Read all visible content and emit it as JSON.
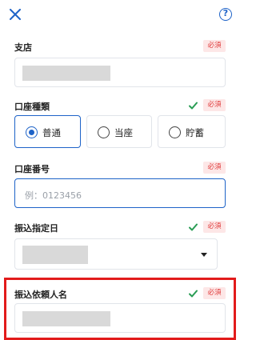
{
  "header": {
    "close_icon": "close-icon",
    "help_icon": "help-circle-icon",
    "help_label": "?"
  },
  "badge_required": "必須",
  "colors": {
    "accent": "#1e63c8",
    "required_bg": "#fde7e7",
    "required_text": "#e03c3c",
    "check": "#2a9d55",
    "highlight": "#e21b1b",
    "mask": "#d9d9d9"
  },
  "fields": {
    "branch": {
      "label": "支店",
      "value": "",
      "masked": true,
      "valid": false
    },
    "account_type": {
      "label": "口座種類",
      "valid": true,
      "options": [
        "普通",
        "当座",
        "貯蓄"
      ],
      "selected": "普通"
    },
    "account_number": {
      "label": "口座番号",
      "placeholder": "例：0123456",
      "valid": false
    },
    "transfer_date": {
      "label": "振込指定日",
      "value": "",
      "masked": true,
      "valid": true
    },
    "requester_name": {
      "label": "振込依頼人名",
      "value": "",
      "masked": true,
      "valid": true,
      "highlighted": true
    }
  }
}
